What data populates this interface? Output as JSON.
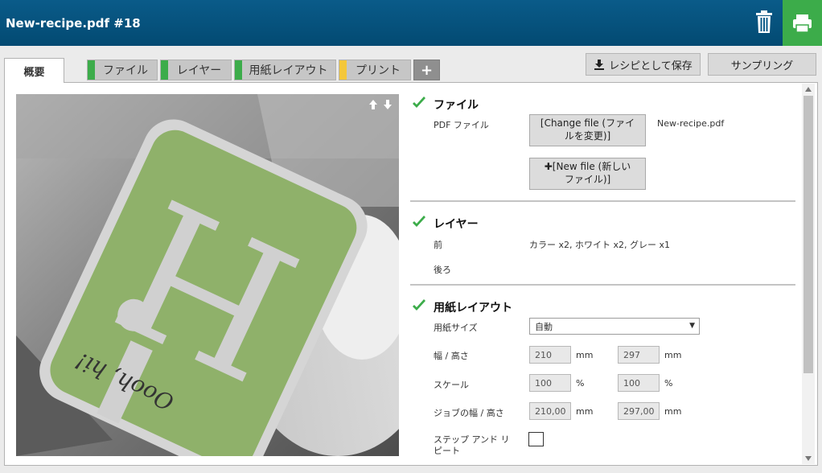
{
  "header": {
    "title": "New-recipe.pdf #18",
    "colors": {
      "bar": "#034a72",
      "print": "#3cac4a"
    }
  },
  "tabs": {
    "active": "概要",
    "items": [
      {
        "label": "ファイル",
        "stripe": "#3cac4a"
      },
      {
        "label": "レイヤー",
        "stripe": "#3cac4a"
      },
      {
        "label": "用紙レイアウト",
        "stripe": "#3cac4a"
      },
      {
        "label": "プリント",
        "stripe": "#f4c73a"
      }
    ],
    "add": "+"
  },
  "toolbar": {
    "save_recipe": "レシピとして保存",
    "sampling": "サンプリング"
  },
  "file_section": {
    "title": "ファイル",
    "pdf_label": "PDF ファイル",
    "change_line1": "[Change file (ファイ",
    "change_line2": "ルを変更)]",
    "filename": "New-recipe.pdf",
    "new_line1": "[New file (新しい",
    "new_line2": "ファイル)]"
  },
  "layer_section": {
    "title": "レイヤー",
    "front_label": "前",
    "front_value": "カラー x2, ホワイト x2, グレー x1",
    "back_label": "後ろ"
  },
  "layout_section": {
    "title": "用紙レイアウト",
    "paper_size_label": "用紙サイズ",
    "paper_size_value": "自動",
    "width_height_label": "幅 / 高さ",
    "width": "210",
    "height": "297",
    "scale_label": "スケール",
    "scale_x": "100",
    "scale_y": "100",
    "job_wh_label": "ジョブの幅 / 高さ",
    "job_width": "210,00",
    "job_height": "297,00",
    "step_repeat_line1": "ステップ アンド リ",
    "step_repeat_line2": "ピート",
    "unit_mm": "mm",
    "unit_pct": "%"
  },
  "preview": {
    "label_text": "Oooh, hi!",
    "colors": {
      "label": "#8fb16a",
      "rim": "#d5d5d5"
    }
  }
}
